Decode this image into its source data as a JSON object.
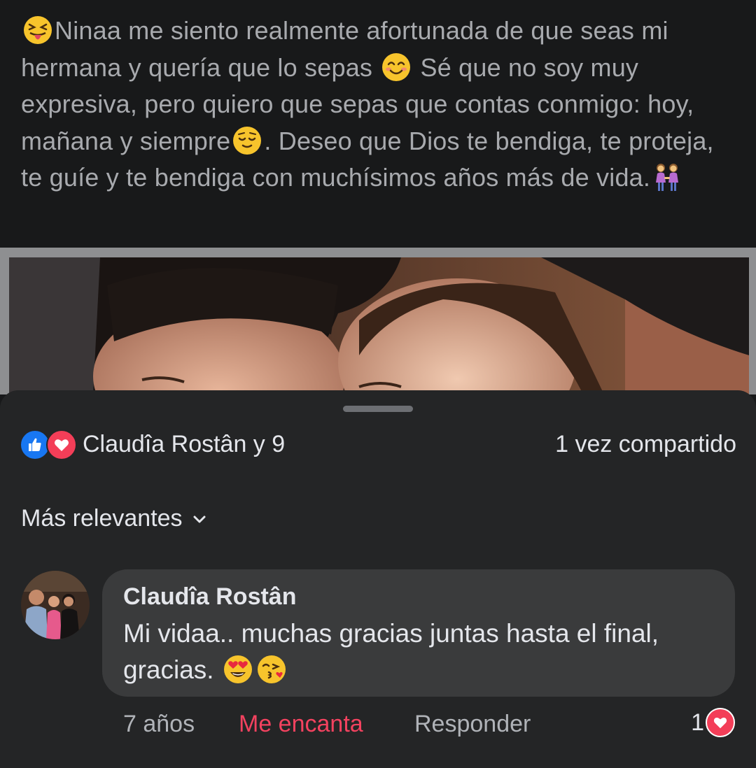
{
  "post": {
    "text_part1": "Ninaa me siento realmente afortunada de que seas mi hermana y quería que lo sepas",
    "text_part2": "Sé que no soy muy expresiva, pero quiero que sepas que contas conmigo: hoy, mañana y siempre",
    "text_part3": ". Deseo que Dios te bendiga, te proteja, te guíe y te bendiga con muchísimos años más de vida.",
    "emojis": [
      "squinting-tongue-face",
      "smiling-face-with-smiling-eyes",
      "relieved-face",
      "two-women-holding-hands"
    ]
  },
  "reactions": {
    "icons": [
      "like-icon",
      "love-icon"
    ],
    "summary": "Claudîa Rostân y 9",
    "shares": "1 vez compartido"
  },
  "sort": {
    "label": "Más relevantes"
  },
  "comment": {
    "author": "Claudîa Rostân",
    "text": "Mi vidaa.. muchas gracias juntas hasta el final, gracias.",
    "emojis": [
      "heart-eyes-face",
      "face-blowing-kiss"
    ],
    "time": "7 años",
    "love_action": "Me encanta",
    "reply_action": "Responder",
    "reaction_count": "1"
  },
  "colors": {
    "background": "#18191a",
    "sheet": "#242526",
    "bubble": "#3a3b3c",
    "like_blue": "#1877f2",
    "love_red": "#f33e58",
    "love_text": "#f3425f"
  }
}
